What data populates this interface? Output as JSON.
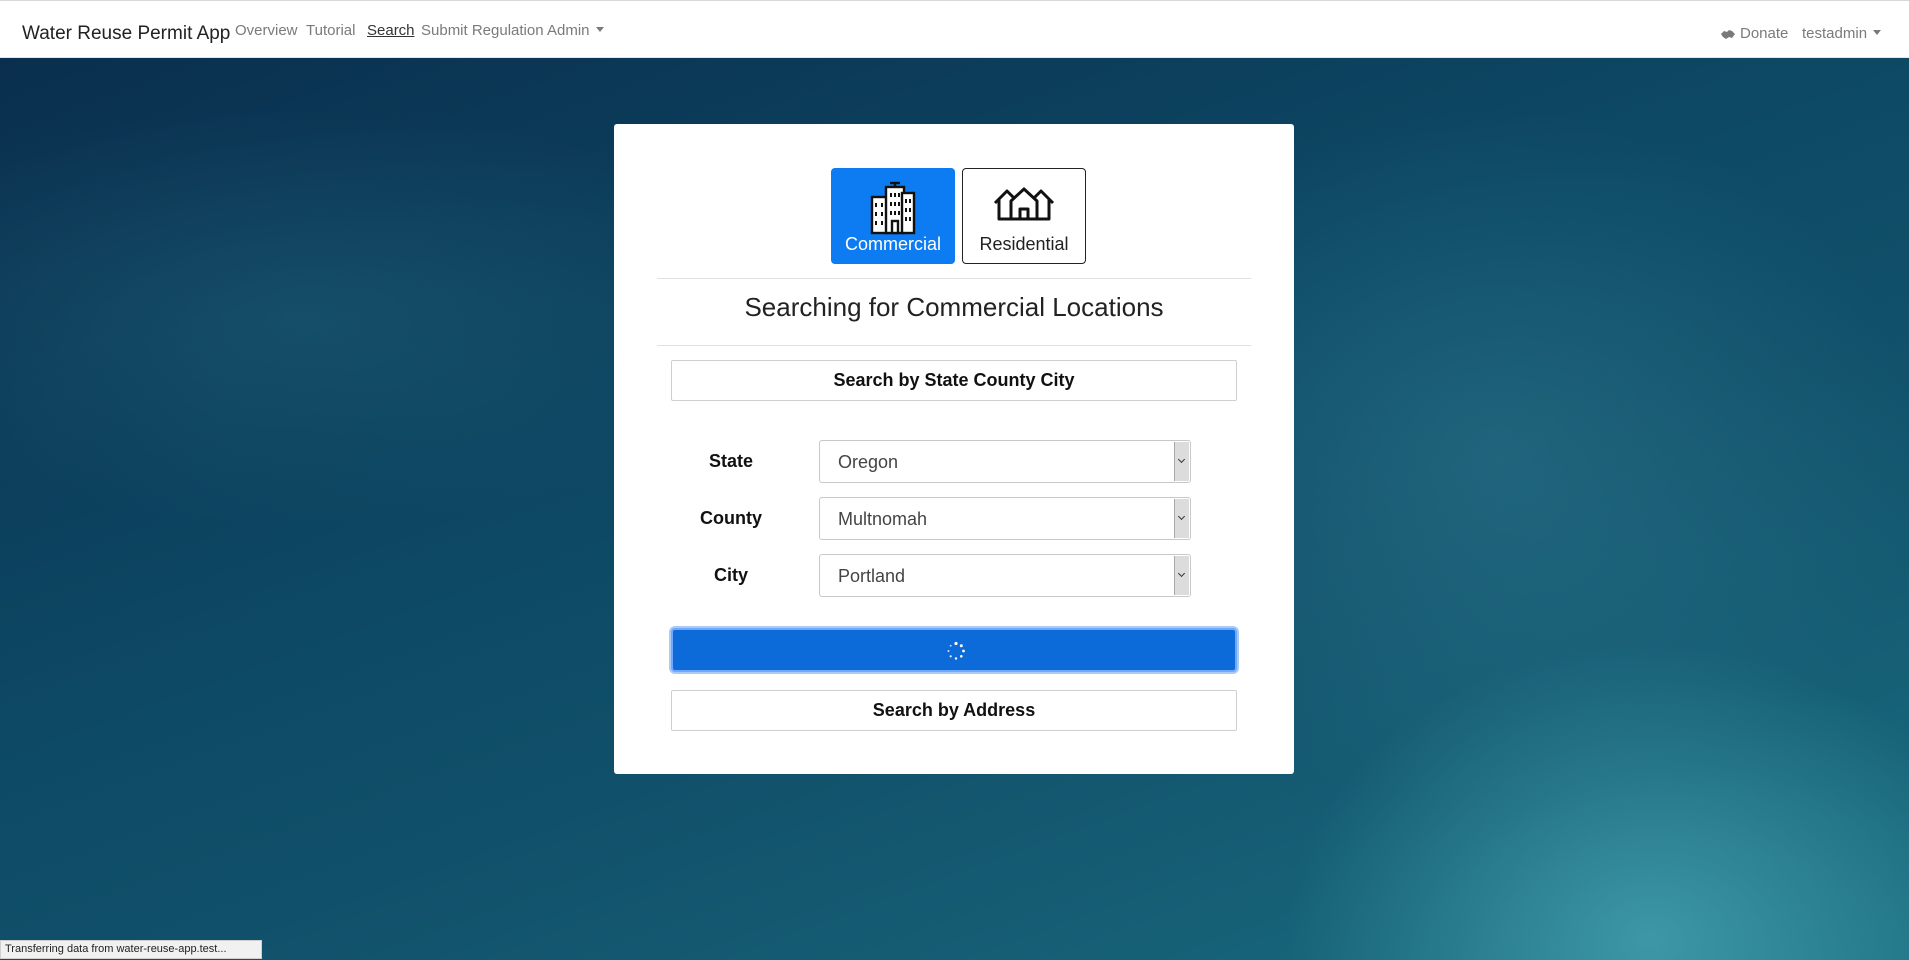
{
  "navbar": {
    "brand": "Water Reuse Permit App",
    "links": [
      {
        "label": "Overview"
      },
      {
        "label": "Tutorial"
      },
      {
        "label": "Search"
      },
      {
        "label": "Submit Regulation"
      },
      {
        "label": "Admin"
      }
    ],
    "donate_label": "Donate",
    "user_label": "testadmin"
  },
  "search_card": {
    "types": [
      {
        "label": "Commercial",
        "icon": "office-buildings-icon",
        "selected": true
      },
      {
        "label": "Residential",
        "icon": "houses-icon",
        "selected": false
      }
    ],
    "heading": "Searching for Commercial Locations",
    "state_county_city_label": "Search by State County City",
    "fields": [
      {
        "label": "State",
        "value": "Oregon"
      },
      {
        "label": "County",
        "value": "Multnomah"
      },
      {
        "label": "City",
        "value": "Portland"
      }
    ],
    "submit_state": "loading",
    "address_label": "Search by Address"
  },
  "status_bar": {
    "text": "Transferring data from water-reuse-app.test..."
  },
  "colors": {
    "primary": "#0d7cf2",
    "submit": "#0d6ad9"
  }
}
